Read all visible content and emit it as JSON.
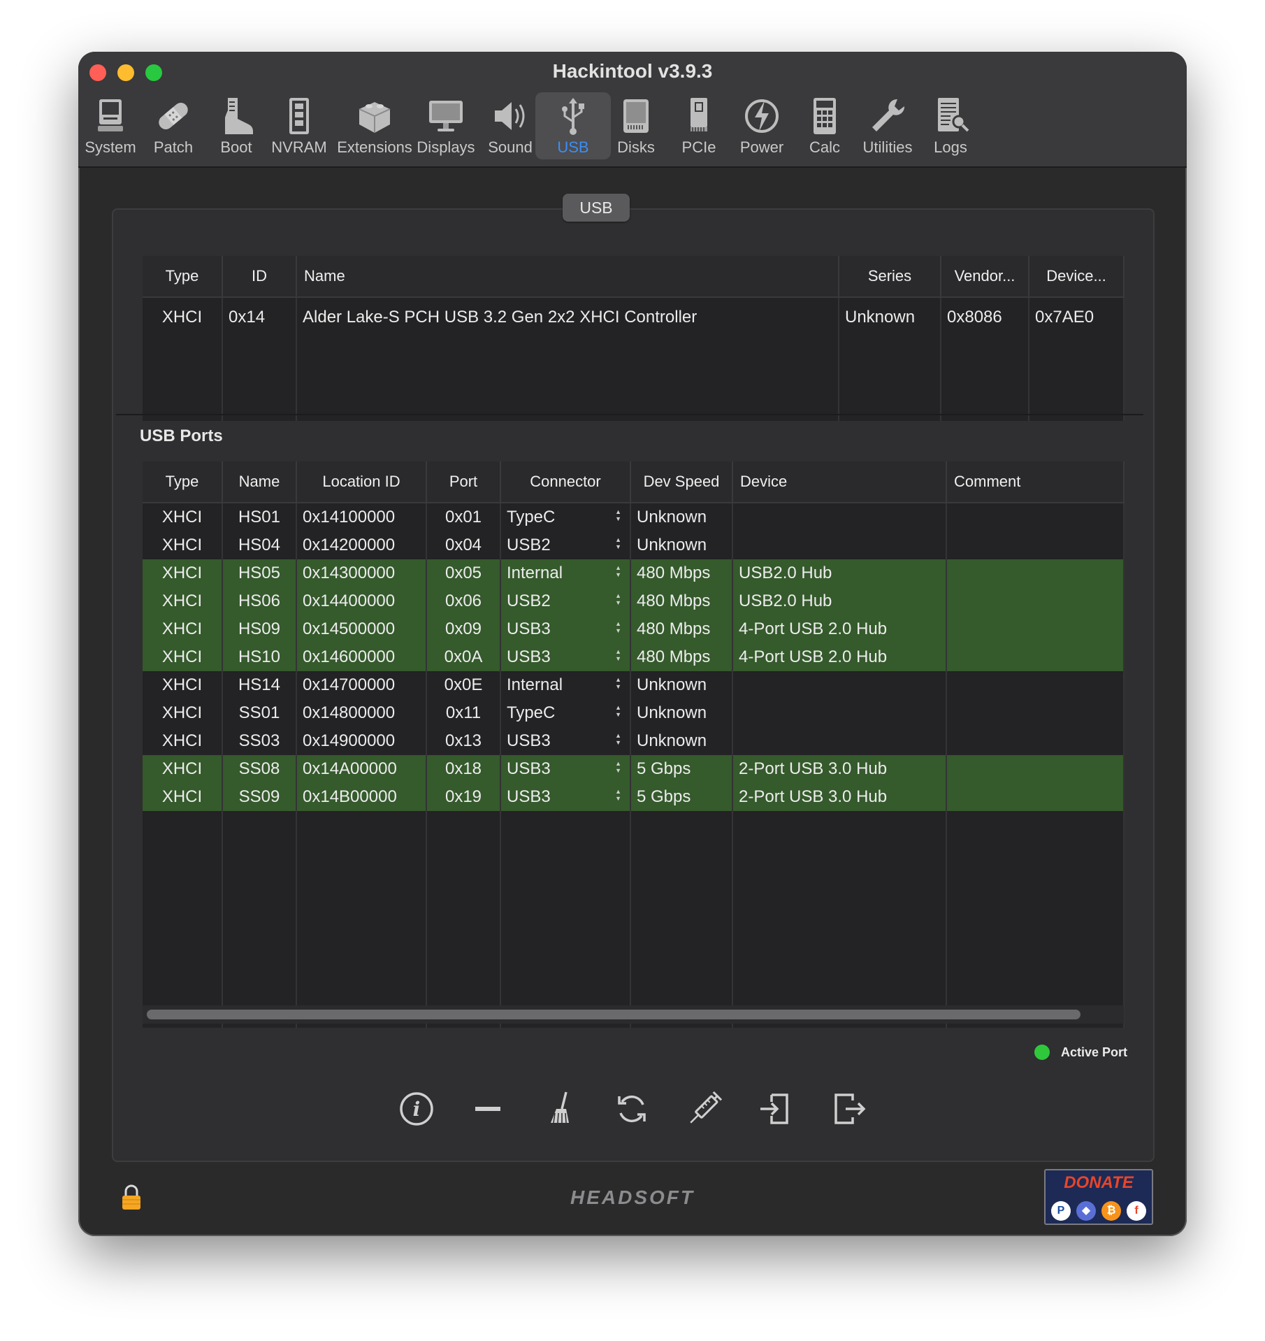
{
  "window": {
    "title": "Hackintool v3.9.3"
  },
  "toolbar": {
    "items": [
      {
        "label": "System",
        "icon": "system-icon"
      },
      {
        "label": "Patch",
        "icon": "bandage-icon"
      },
      {
        "label": "Boot",
        "icon": "boot-icon"
      },
      {
        "label": "NVRAM",
        "icon": "memory-icon"
      },
      {
        "label": "Extensions",
        "icon": "extension-icon"
      },
      {
        "label": "Displays",
        "icon": "display-icon"
      },
      {
        "label": "Sound",
        "icon": "speaker-icon"
      },
      {
        "label": "USB",
        "icon": "usb-icon",
        "active": true
      },
      {
        "label": "Disks",
        "icon": "disk-icon"
      },
      {
        "label": "PCIe",
        "icon": "pcie-icon"
      },
      {
        "label": "Power",
        "icon": "power-icon"
      },
      {
        "label": "Calc",
        "icon": "calculator-icon"
      },
      {
        "label": "Utilities",
        "icon": "wrench-icon"
      },
      {
        "label": "Logs",
        "icon": "logs-icon"
      }
    ]
  },
  "group_label": "USB",
  "controllers": {
    "columns": [
      "Type",
      "ID",
      "Name",
      "Series",
      "Vendor...",
      "Device..."
    ],
    "rows": [
      [
        "XHCI",
        "0x14",
        "Alder Lake-S PCH USB 3.2 Gen 2x2 XHCI Controller",
        "Unknown",
        "0x8086",
        "0x7AE0"
      ]
    ]
  },
  "ports": {
    "section_title": "USB Ports",
    "columns": [
      "Type",
      "Name",
      "Location ID",
      "Port",
      "Connector",
      "Dev Speed",
      "Device",
      "Comment"
    ],
    "rows": [
      {
        "type": "XHCI",
        "name": "HS01",
        "location": "0x14100000",
        "port": "0x01",
        "connector": "TypeC",
        "speed": "Unknown",
        "device": "",
        "comment": "",
        "active": false
      },
      {
        "type": "XHCI",
        "name": "HS04",
        "location": "0x14200000",
        "port": "0x04",
        "connector": "USB2",
        "speed": "Unknown",
        "device": "",
        "comment": "",
        "active": false
      },
      {
        "type": "XHCI",
        "name": "HS05",
        "location": "0x14300000",
        "port": "0x05",
        "connector": "Internal",
        "speed": "480 Mbps",
        "device": "USB2.0 Hub",
        "comment": "",
        "active": true
      },
      {
        "type": "XHCI",
        "name": "HS06",
        "location": "0x14400000",
        "port": "0x06",
        "connector": "USB2",
        "speed": "480 Mbps",
        "device": "USB2.0 Hub",
        "comment": "",
        "active": true
      },
      {
        "type": "XHCI",
        "name": "HS09",
        "location": "0x14500000",
        "port": "0x09",
        "connector": "USB3",
        "speed": "480 Mbps",
        "device": "4-Port USB 2.0 Hub",
        "comment": "",
        "active": true
      },
      {
        "type": "XHCI",
        "name": "HS10",
        "location": "0x14600000",
        "port": "0x0A",
        "connector": "USB3",
        "speed": "480 Mbps",
        "device": "4-Port USB 2.0 Hub",
        "comment": "",
        "active": true
      },
      {
        "type": "XHCI",
        "name": "HS14",
        "location": "0x14700000",
        "port": "0x0E",
        "connector": "Internal",
        "speed": "Unknown",
        "device": "",
        "comment": "",
        "active": false
      },
      {
        "type": "XHCI",
        "name": "SS01",
        "location": "0x14800000",
        "port": "0x11",
        "connector": "TypeC",
        "speed": "Unknown",
        "device": "",
        "comment": "",
        "active": false
      },
      {
        "type": "XHCI",
        "name": "SS03",
        "location": "0x14900000",
        "port": "0x13",
        "connector": "USB3",
        "speed": "Unknown",
        "device": "",
        "comment": "",
        "active": false
      },
      {
        "type": "XHCI",
        "name": "SS08",
        "location": "0x14A00000",
        "port": "0x18",
        "connector": "USB3",
        "speed": "5 Gbps",
        "device": "2-Port USB 3.0 Hub",
        "comment": "",
        "active": true
      },
      {
        "type": "XHCI",
        "name": "SS09",
        "location": "0x14B00000",
        "port": "0x19",
        "connector": "USB3",
        "speed": "5 Gbps",
        "device": "2-Port USB 3.0 Hub",
        "comment": "",
        "active": true
      }
    ]
  },
  "legend": {
    "label": "Active Port",
    "color": "#2fc83c"
  },
  "actions": [
    {
      "icon": "info-icon"
    },
    {
      "icon": "minus-icon"
    },
    {
      "icon": "broom-icon"
    },
    {
      "icon": "refresh-icon"
    },
    {
      "icon": "syringe-icon"
    },
    {
      "icon": "import-icon"
    },
    {
      "icon": "export-icon"
    }
  ],
  "footer": {
    "brand": "HEADSOFT",
    "donate_label": "DONATE",
    "lock_icon": "lock-icon"
  },
  "colors": {
    "accent": "#3a8ff6",
    "active_row": "#355a2c"
  }
}
